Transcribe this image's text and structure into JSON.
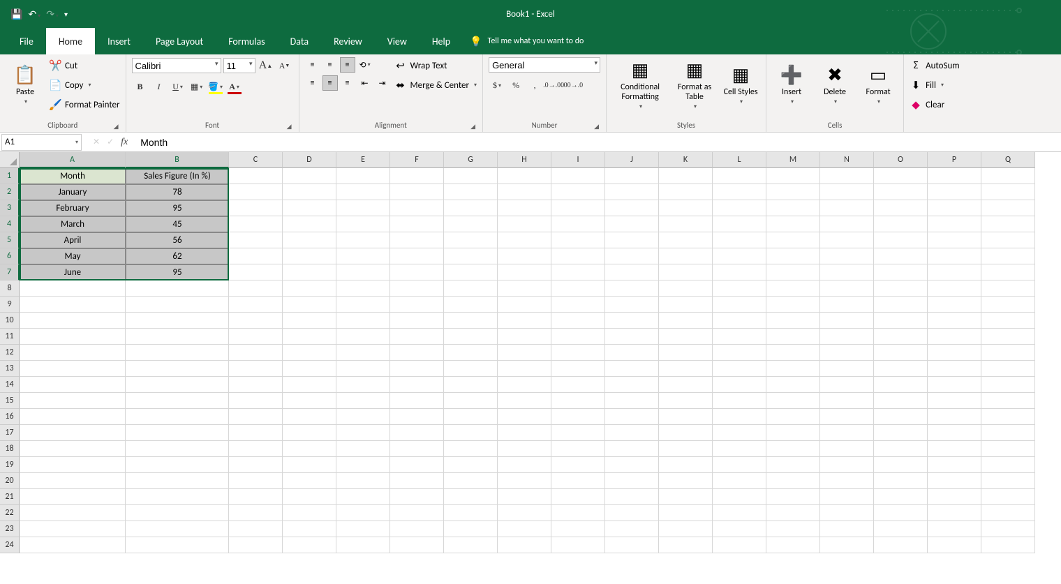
{
  "app": {
    "title": "Book1  -  Excel"
  },
  "tabs": [
    "File",
    "Home",
    "Insert",
    "Page Layout",
    "Formulas",
    "Data",
    "Review",
    "View",
    "Help"
  ],
  "tab_active": "Home",
  "tellme": "Tell me what you want to do",
  "ribbon": {
    "clipboard": {
      "paste": "Paste",
      "cut": "Cut",
      "copy": "Copy",
      "fmtpainter": "Format Painter",
      "label": "Clipboard"
    },
    "font": {
      "name": "Calibri",
      "size": "11",
      "label": "Font"
    },
    "alignment": {
      "wrap": "Wrap Text",
      "merge": "Merge & Center",
      "label": "Alignment"
    },
    "number": {
      "fmt": "General",
      "label": "Number"
    },
    "styles": {
      "cond": "Conditional Formatting",
      "table": "Format as Table",
      "cell": "Cell Styles",
      "label": "Styles"
    },
    "cells": {
      "insert": "Insert",
      "delete": "Delete",
      "format": "Format",
      "label": "Cells"
    },
    "editing": {
      "autosum": "AutoSum",
      "fill": "Fill",
      "clear": "Clear"
    }
  },
  "namebox": "A1",
  "formula": "Month",
  "columns": [
    "A",
    "B",
    "C",
    "D",
    "E",
    "F",
    "G",
    "H",
    "I",
    "J",
    "K",
    "L",
    "M",
    "N",
    "O",
    "P",
    "Q"
  ],
  "rows": 24,
  "selectedCols": [
    "A",
    "B"
  ],
  "selectedRows": [
    1,
    2,
    3,
    4,
    5,
    6,
    7
  ],
  "sheet": {
    "headers": [
      "Month",
      "Sales Figure (In %)"
    ],
    "data": [
      [
        "January",
        78
      ],
      [
        "February",
        95
      ],
      [
        "March",
        45
      ],
      [
        "April",
        56
      ],
      [
        "May",
        62
      ],
      [
        "June",
        95
      ]
    ]
  },
  "chart_data": {
    "type": "table",
    "title": "Sales Figure (In %) by Month",
    "categories": [
      "January",
      "February",
      "March",
      "April",
      "May",
      "June"
    ],
    "values": [
      78,
      95,
      45,
      56,
      62,
      95
    ],
    "xlabel": "Month",
    "ylabel": "Sales Figure (In %)"
  }
}
